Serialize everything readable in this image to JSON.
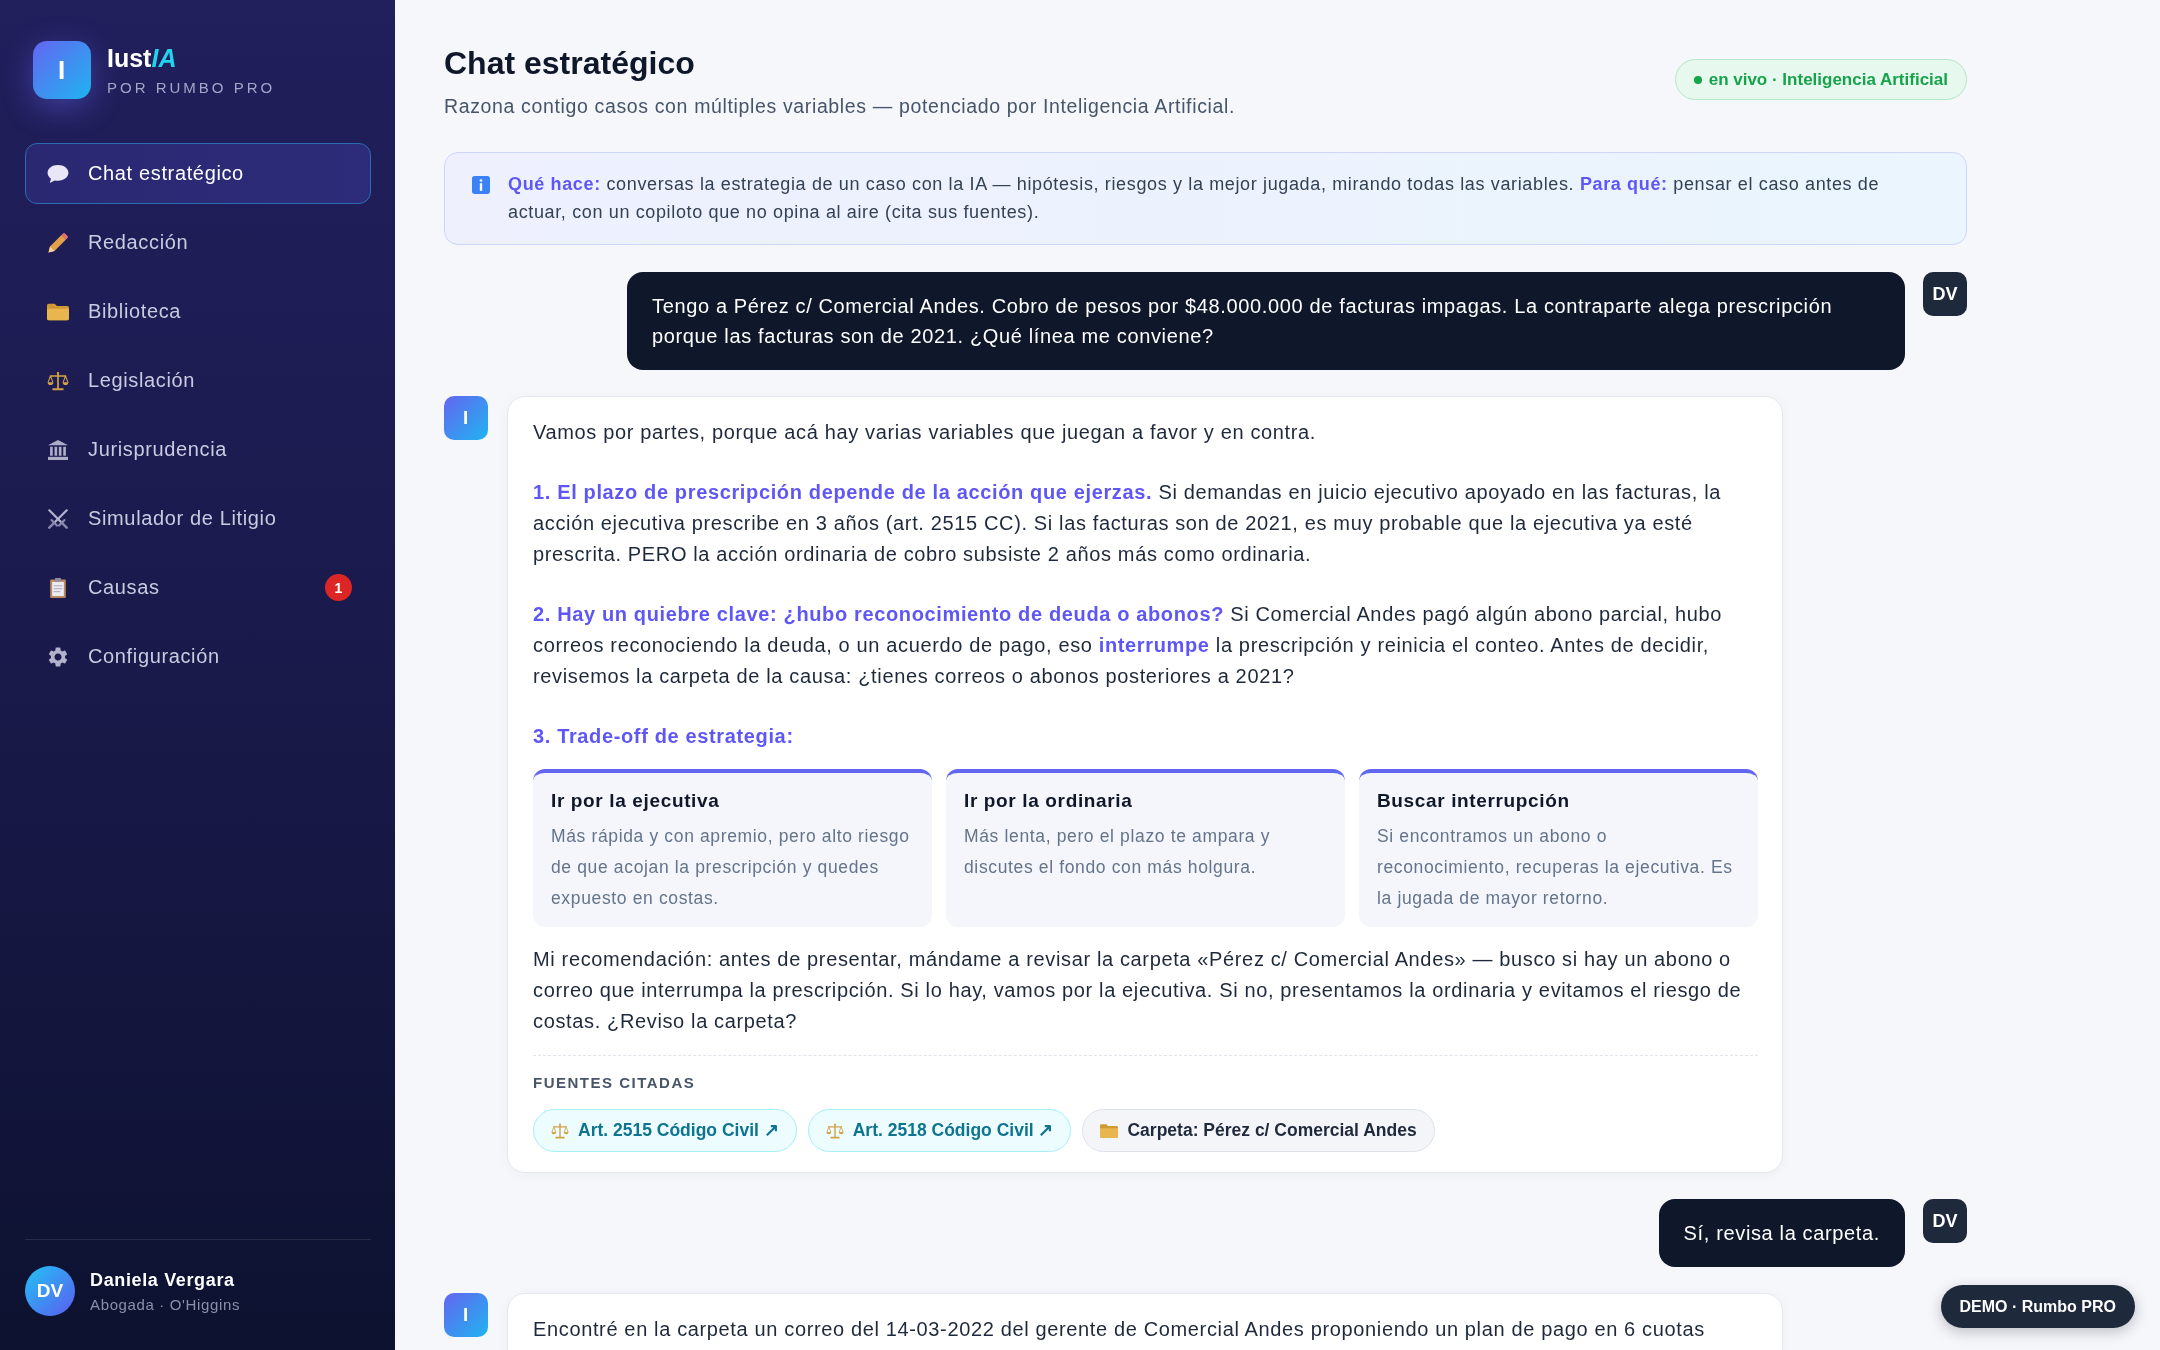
{
  "sidebar": {
    "brand": {
      "logo": "I",
      "name": "Iust",
      "name_accent": "IA",
      "tagline": "POR RUMBO PRO"
    },
    "nav": [
      {
        "label": "Chat estratégico",
        "selected": true
      },
      {
        "label": "Redacción",
        "selected": false
      },
      {
        "label": "Biblioteca",
        "selected": false
      },
      {
        "label": "Legislación",
        "selected": false
      },
      {
        "label": "Jurisprudencia",
        "selected": false
      },
      {
        "label": "Simulador de Litigio",
        "selected": false
      },
      {
        "label": "Causas",
        "selected": false,
        "badge": "1"
      },
      {
        "label": "Configuración",
        "selected": false
      }
    ],
    "user": {
      "initials": "DV",
      "name": "Daniela Vergara",
      "role": "Abogada · O'Higgins"
    }
  },
  "header": {
    "title": "Chat estratégico",
    "subtitle": "Razona contigo casos con múltiples variables — potenciado por Inteligencia Artificial.",
    "status": "en vivo · Inteligencia Artificial"
  },
  "info": {
    "text": "**Qué hace:** conversas la estrategia de un caso con la IA — hipótesis, riesgos y la mejor jugada, mirando todas las variables. **Para qué:** pensar el caso antes de actuar, con un copiloto que no opina al aire (cita sus fuentes)."
  },
  "messages": [
    {
      "kind": "user",
      "avatar": "DV",
      "text": "Tengo a Pérez c/ Comercial Andes. Cobro de pesos por $48.000.000 de facturas impagas. La contraparte alega prescripción porque las facturas son de 2021. ¿Qué línea me conviene?"
    },
    {
      "kind": "assistant",
      "avatar": "I",
      "blocks": [
        {
          "kind": "paragraph",
          "text": "Vamos por partes, porque acá hay varias variables que juegan a favor y en contra."
        },
        {
          "kind": "paragraph",
          "text": "**1. El plazo de prescripción depende de la acción que ejerzas.** Si demandas en juicio ejecutivo apoyado en las facturas, la acción ejecutiva prescribe en 3 años (art. 2515 CC). Si las facturas son de 2021, es muy probable que la ejecutiva ya esté prescrita. PERO la acción ordinaria de cobro subsiste 2 años más como ordinaria."
        },
        {
          "kind": "paragraph",
          "text": "**2. Hay un quiebre clave: ¿hubo reconocimiento de deuda o abonos?** Si Comercial Andes pagó algún abono parcial, hubo correos reconociendo la deuda, o un acuerdo de pago, eso **interrumpe** la prescripción y reinicia el conteo. Antes de decidir, revisemos la carpeta de la causa: ¿tienes correos o abonos posteriores a 2021?"
        },
        {
          "kind": "heading",
          "text": "3. Trade-off de estrategia:"
        },
        {
          "kind": "options",
          "items": [
            {
              "title": "Ir por la ejecutiva",
              "text": "Más rápida y con apremio, pero alto riesgo de que acojan la prescripción y quedes expuesto en costas."
            },
            {
              "title": "Ir por la ordinaria",
              "text": "Más lenta, pero el plazo te ampara y discutes el fondo con más holgura."
            },
            {
              "title": "Buscar interrupción",
              "text": "Si encontramos un abono o reconocimiento, recuperas la ejecutiva. Es la jugada de mayor retorno."
            }
          ]
        },
        {
          "kind": "paragraph",
          "text": "Mi recomendación: antes de presentar, mándame a revisar la carpeta «Pérez c/ Comercial Andes» — busco si hay un abono o correo que interrumpa la prescripción. Si lo hay, vamos por la ejecutiva. Si no, presentamos la ordinaria y evitamos el riesgo de costas. ¿Reviso la carpeta?"
        }
      ],
      "sources": {
        "label": "FUENTES CITADAS",
        "items": [
          {
            "kind": "law",
            "label": "Art. 2515 Código Civil ↗"
          },
          {
            "kind": "law",
            "label": "Art. 2518 Código Civil ↗"
          },
          {
            "kind": "folder",
            "label": "Carpeta: Pérez c/ Comercial Andes"
          }
        ]
      }
    },
    {
      "kind": "user",
      "avatar": "DV",
      "text": "Sí, revisa la carpeta."
    },
    {
      "kind": "assistant",
      "avatar": "I",
      "blocks": [
        {
          "kind": "paragraph",
          "text": "Encontré en la carpeta un correo del 14-03-2022 del gerente de Comercial Andes proponiendo un plan de pago en 6 cuotas"
        }
      ]
    }
  ],
  "demo_badge": "DEMO · Rumbo PRO"
}
